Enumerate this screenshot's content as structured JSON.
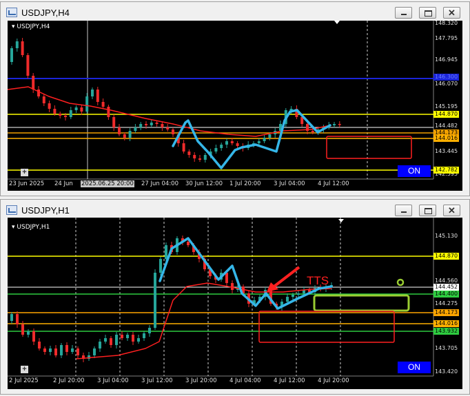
{
  "windows": [
    {
      "title": "USDJPY,H4",
      "symbol_label": "USDJPY,H4",
      "price_labels": [
        "148.320",
        "147.795",
        "146.945",
        "146.070",
        "145.195",
        "144.482",
        "143.445",
        "142.595"
      ],
      "price_tags": [
        {
          "value": "146.300",
          "color": "#1a24d8"
        },
        {
          "value": "144.870",
          "color": "#ffff00"
        },
        {
          "value": "144.173",
          "color": "#f0a000"
        },
        {
          "value": "144.016",
          "color": "#ffb000"
        },
        {
          "value": "142.782",
          "color": "#ffff00"
        }
      ],
      "time_labels": [
        "23 Jun 2025",
        "24 Jun",
        "27 Jun 04:00",
        "30 Jun 12:00",
        "1 Jul 20:00",
        "3 Jul 04:00",
        "4 Jul 12:00"
      ],
      "hover_time_label": "2025.06.25 20:00",
      "on_button": "ON"
    },
    {
      "title": "USDJPY,H1",
      "symbol_label": "USDJPY,H1",
      "price_labels": [
        "145.130",
        "144.560",
        "144.275",
        "143.705",
        "143.420"
      ],
      "price_tags": [
        {
          "value": "144.870",
          "color": "#ffff00"
        },
        {
          "value": "144.452",
          "color": "#ffffff"
        },
        {
          "value": "144.400",
          "color": "#2ecc40"
        },
        {
          "value": "144.173",
          "color": "#ffa500"
        },
        {
          "value": "144.016",
          "color": "#ffb000"
        },
        {
          "value": "143.932",
          "color": "#2ecc40"
        }
      ],
      "time_labels": [
        "2 Jul 2025",
        "2 Jul 20:00",
        "3 Jul 04:00",
        "3 Jul 12:00",
        "3 Jul 20:00",
        "4 Jul 04:00",
        "4 Jul 12:00",
        "4 Jul 20:00"
      ],
      "annotation": "TTS",
      "on_button": "ON"
    }
  ]
}
